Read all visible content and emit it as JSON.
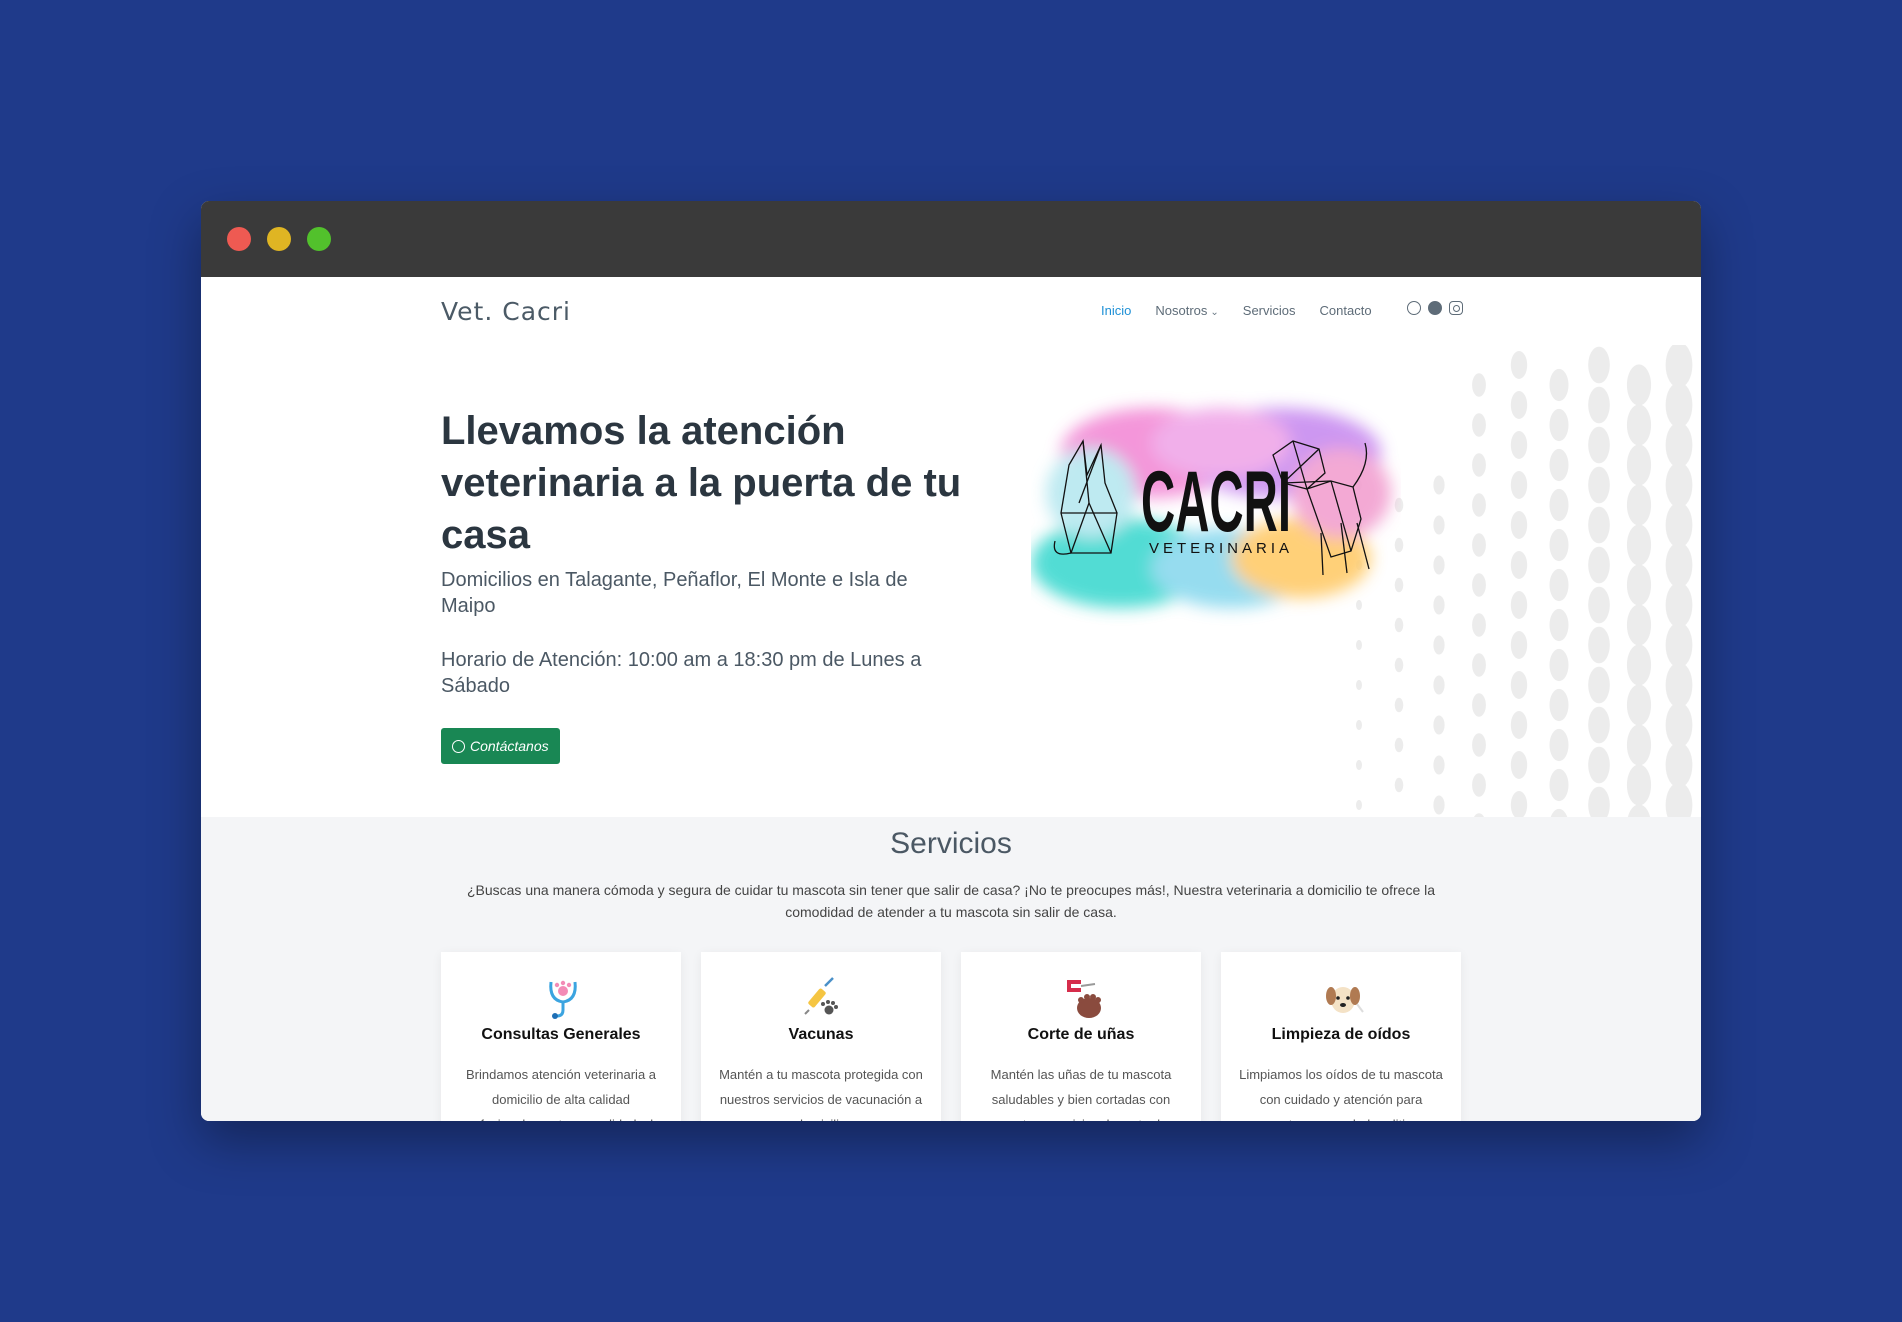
{
  "header": {
    "logo": "Vet. Cacri",
    "nav": [
      "Inicio",
      "Nosotros",
      "Servicios",
      "Contacto"
    ]
  },
  "hero": {
    "title": "Llevamos la atención veterinaria a la puerta de tu casa",
    "subtitle": "Domicilios en Talagante, Peñaflor, El Monte e Isla de Maipo",
    "hours": "Horario de Atención: 10:00 am a 18:30 pm de Lunes a Sábado",
    "cta": "Contáctanos",
    "brand_name": "CACRI",
    "brand_tag": "VETERINARIA"
  },
  "services": {
    "title": "Servicios",
    "description": "¿Buscas una manera cómoda y segura de cuidar tu mascota sin tener que salir de casa? ¡No te preocupes más!, Nuestra veterinaria a domicilio te ofrece la comodidad de atender a tu mascota sin salir de casa.",
    "cards": [
      {
        "title": "Consultas Generales",
        "text": "Brindamos atención veterinaria a domicilio de alta calidad profesional para tu comodidad y la",
        "icon": "stethoscope-paw-icon"
      },
      {
        "title": "Vacunas",
        "text": "Mantén a tu mascota protegida con nuestros servicios de vacunación a domicilio",
        "icon": "syringe-paw-icon"
      },
      {
        "title": "Corte de uñas",
        "text": "Mantén las uñas de tu mascota saludables y bien cortadas con nuestros servicios de corte de",
        "icon": "nail-clipper-icon"
      },
      {
        "title": "Limpieza de oídos",
        "text": "Limpiamos los oídos de tu mascota con cuidado y atención para mantener su salud auditiva",
        "icon": "dog-face-icon"
      }
    ]
  },
  "colors": {
    "page_bg": "#1f3a8a",
    "accent": "#1e90d6",
    "cta_green": "#198754"
  }
}
